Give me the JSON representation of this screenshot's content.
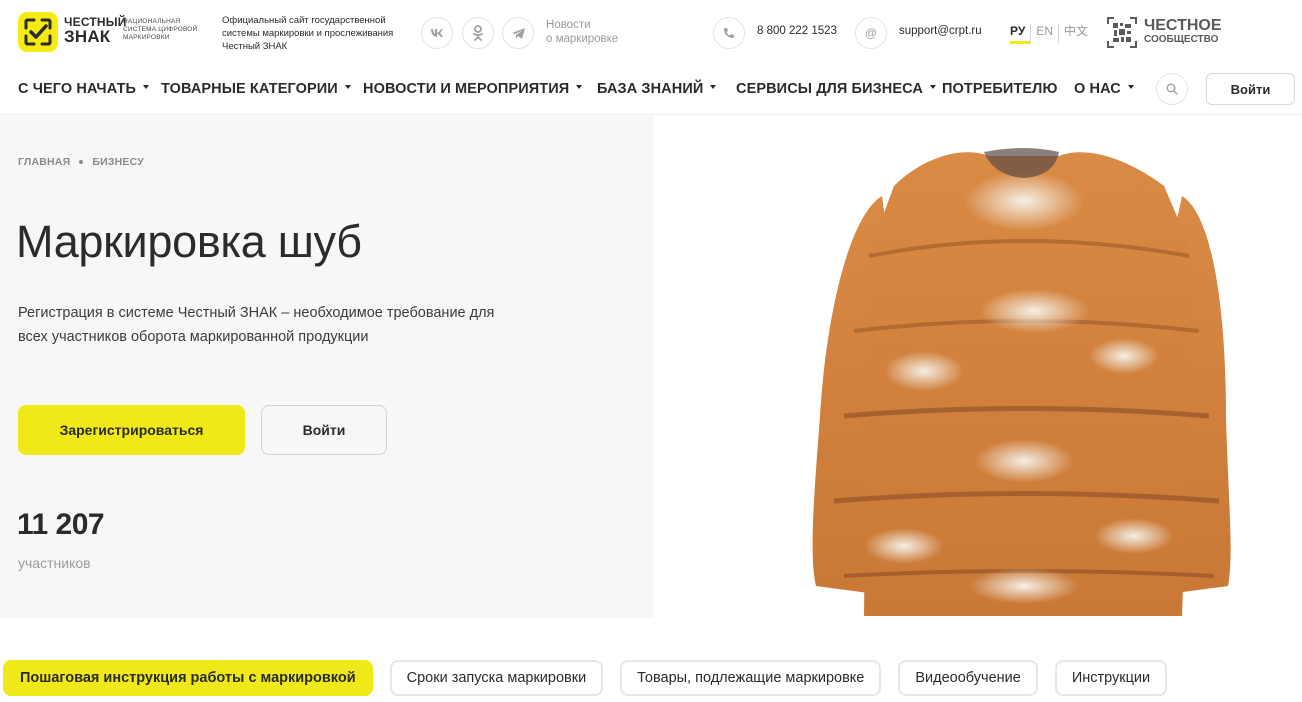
{
  "colors": {
    "accent": "#f0e91a",
    "text": "#2b2b2b",
    "muted": "#9a9a9a",
    "hero_bg": "#f7f7f7"
  },
  "header": {
    "logo_line1": "ЧЕСТНЫЙ",
    "logo_line2": "ЗНАК",
    "logo_sub": "НАЦИОНАЛЬНАЯ СИСТЕМА ЦИФРОВОЙ МАРКИРОВКИ",
    "official_text": "Официальный сайт государственной системы маркировки и прослеживания Честный ЗНАК",
    "socials": [
      {
        "name": "vk-icon",
        "glyph": "vk"
      },
      {
        "name": "odnoklassniki-icon",
        "glyph": "ok"
      },
      {
        "name": "telegram-icon",
        "glyph": "tg"
      }
    ],
    "news_link_line1": "Новости",
    "news_link_line2": "о маркировке",
    "phone": "8 800 222 1523",
    "email": "support@crpt.ru",
    "email_icon_glyph": "@",
    "languages": [
      "РУ",
      "EN",
      "中文"
    ],
    "community_line1": "ЧЕСТНОЕ",
    "community_line2": "СООБЩЕСТВО"
  },
  "nav": {
    "items": [
      {
        "label": "С ЧЕГО НАЧАТЬ",
        "dropdown": true
      },
      {
        "label": "ТОВАРНЫЕ КАТЕГОРИИ",
        "dropdown": true
      },
      {
        "label": "НОВОСТИ И МЕРОПРИЯТИЯ",
        "dropdown": true
      },
      {
        "label": "БАЗА ЗНАНИЙ",
        "dropdown": true
      },
      {
        "label": "СЕРВИСЫ ДЛЯ БИЗНЕСА",
        "dropdown": true
      },
      {
        "label": "ПОТРЕБИТЕЛЮ",
        "dropdown": false
      },
      {
        "label": "О НАС",
        "dropdown": true
      }
    ],
    "login_label": "Войти"
  },
  "hero": {
    "breadcrumb": [
      "ГЛАВНАЯ",
      "БИЗНЕСУ"
    ],
    "title": "Маркировка шуб",
    "lead": "Регистрация в системе Честный ЗНАК – необходимое требование для всех участников оборота маркированной продукции",
    "register_label": "Зарегистрироваться",
    "login_label": "Войти",
    "participants_count": "11 207",
    "participants_label": "участников"
  },
  "tabs": [
    {
      "label": "Пошаговая инструкция работы с маркировкой",
      "active": true
    },
    {
      "label": "Сроки запуска маркировки",
      "active": false
    },
    {
      "label": "Товары, подлежащие маркировке",
      "active": false
    },
    {
      "label": "Видеообучение",
      "active": false
    },
    {
      "label": "Инструкции",
      "active": false
    }
  ]
}
